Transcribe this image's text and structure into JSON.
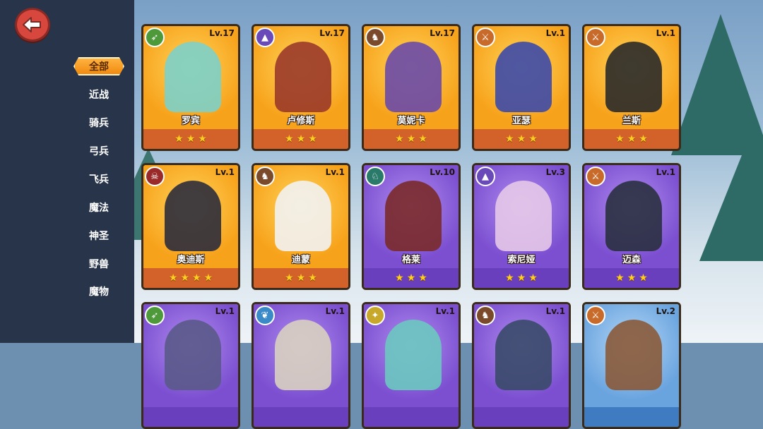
{
  "back_icon": "back-arrow-icon",
  "categories": [
    "全部",
    "近战",
    "骑兵",
    "弓兵",
    "飞兵",
    "魔法",
    "神圣",
    "野兽",
    "魔物"
  ],
  "active_category": "全部",
  "colors": {
    "orange": "#f7a21b",
    "purple": "#7b4fd0",
    "blue": "#6aa4df",
    "sidebar": "#28344a",
    "back": "#d8473d"
  },
  "heroes": [
    {
      "name": "罗宾",
      "level": "Lv.17",
      "stars": 3,
      "class_icon": "bow-icon",
      "rarity": "orange",
      "figure": "#7cd0c9"
    },
    {
      "name": "卢修斯",
      "level": "Lv.17",
      "stars": 3,
      "class_icon": "wizard-hat-icon",
      "rarity": "orange",
      "figure": "#9a3a2a"
    },
    {
      "name": "莫妮卡",
      "level": "Lv.17",
      "stars": 3,
      "class_icon": "wolf-icon",
      "rarity": "orange",
      "figure": "#6a4aa8"
    },
    {
      "name": "亚瑟",
      "level": "Lv.1",
      "stars": 3,
      "class_icon": "sword-icon",
      "rarity": "orange",
      "figure": "#3d4aa8"
    },
    {
      "name": "兰斯",
      "level": "Lv.1",
      "stars": 3,
      "class_icon": "sword-icon",
      "rarity": "orange",
      "figure": "#2a2a2a"
    },
    {
      "name": "奥迪斯",
      "level": "Lv.1",
      "stars": 4,
      "class_icon": "skull-icon",
      "rarity": "orange",
      "figure": "#2c2c3c"
    },
    {
      "name": "迪蒙",
      "level": "Lv.1",
      "stars": 3,
      "class_icon": "wolf-icon",
      "rarity": "orange",
      "figure": "#f2f2f2"
    },
    {
      "name": "格莱",
      "level": "Lv.10",
      "stars": 3,
      "class_icon": "horse-icon",
      "rarity": "purple",
      "figure": "#7a2a2a"
    },
    {
      "name": "索尼娅",
      "level": "Lv.3",
      "stars": 3,
      "class_icon": "wizard-hat-icon",
      "rarity": "purple",
      "figure": "#e6c8e8"
    },
    {
      "name": "迈森",
      "level": "Lv.1",
      "stars": 3,
      "class_icon": "sword-icon",
      "rarity": "purple",
      "figure": "#2a3040"
    },
    {
      "name": "",
      "level": "Lv.1",
      "stars": 0,
      "class_icon": "bow-icon",
      "rarity": "purple",
      "figure": "#5a5a8a"
    },
    {
      "name": "",
      "level": "Lv.1",
      "stars": 0,
      "class_icon": "wings-icon",
      "rarity": "purple",
      "figure": "#d8d0c0"
    },
    {
      "name": "",
      "level": "Lv.1",
      "stars": 0,
      "class_icon": "wand-icon",
      "rarity": "purple",
      "figure": "#6ac8c0"
    },
    {
      "name": "",
      "level": "Lv.1",
      "stars": 0,
      "class_icon": "wolf-icon",
      "rarity": "purple",
      "figure": "#3a4a6a"
    },
    {
      "name": "",
      "level": "Lv.2",
      "stars": 0,
      "class_icon": "sword-icon",
      "rarity": "blue",
      "figure": "#8a5a3a"
    }
  ]
}
